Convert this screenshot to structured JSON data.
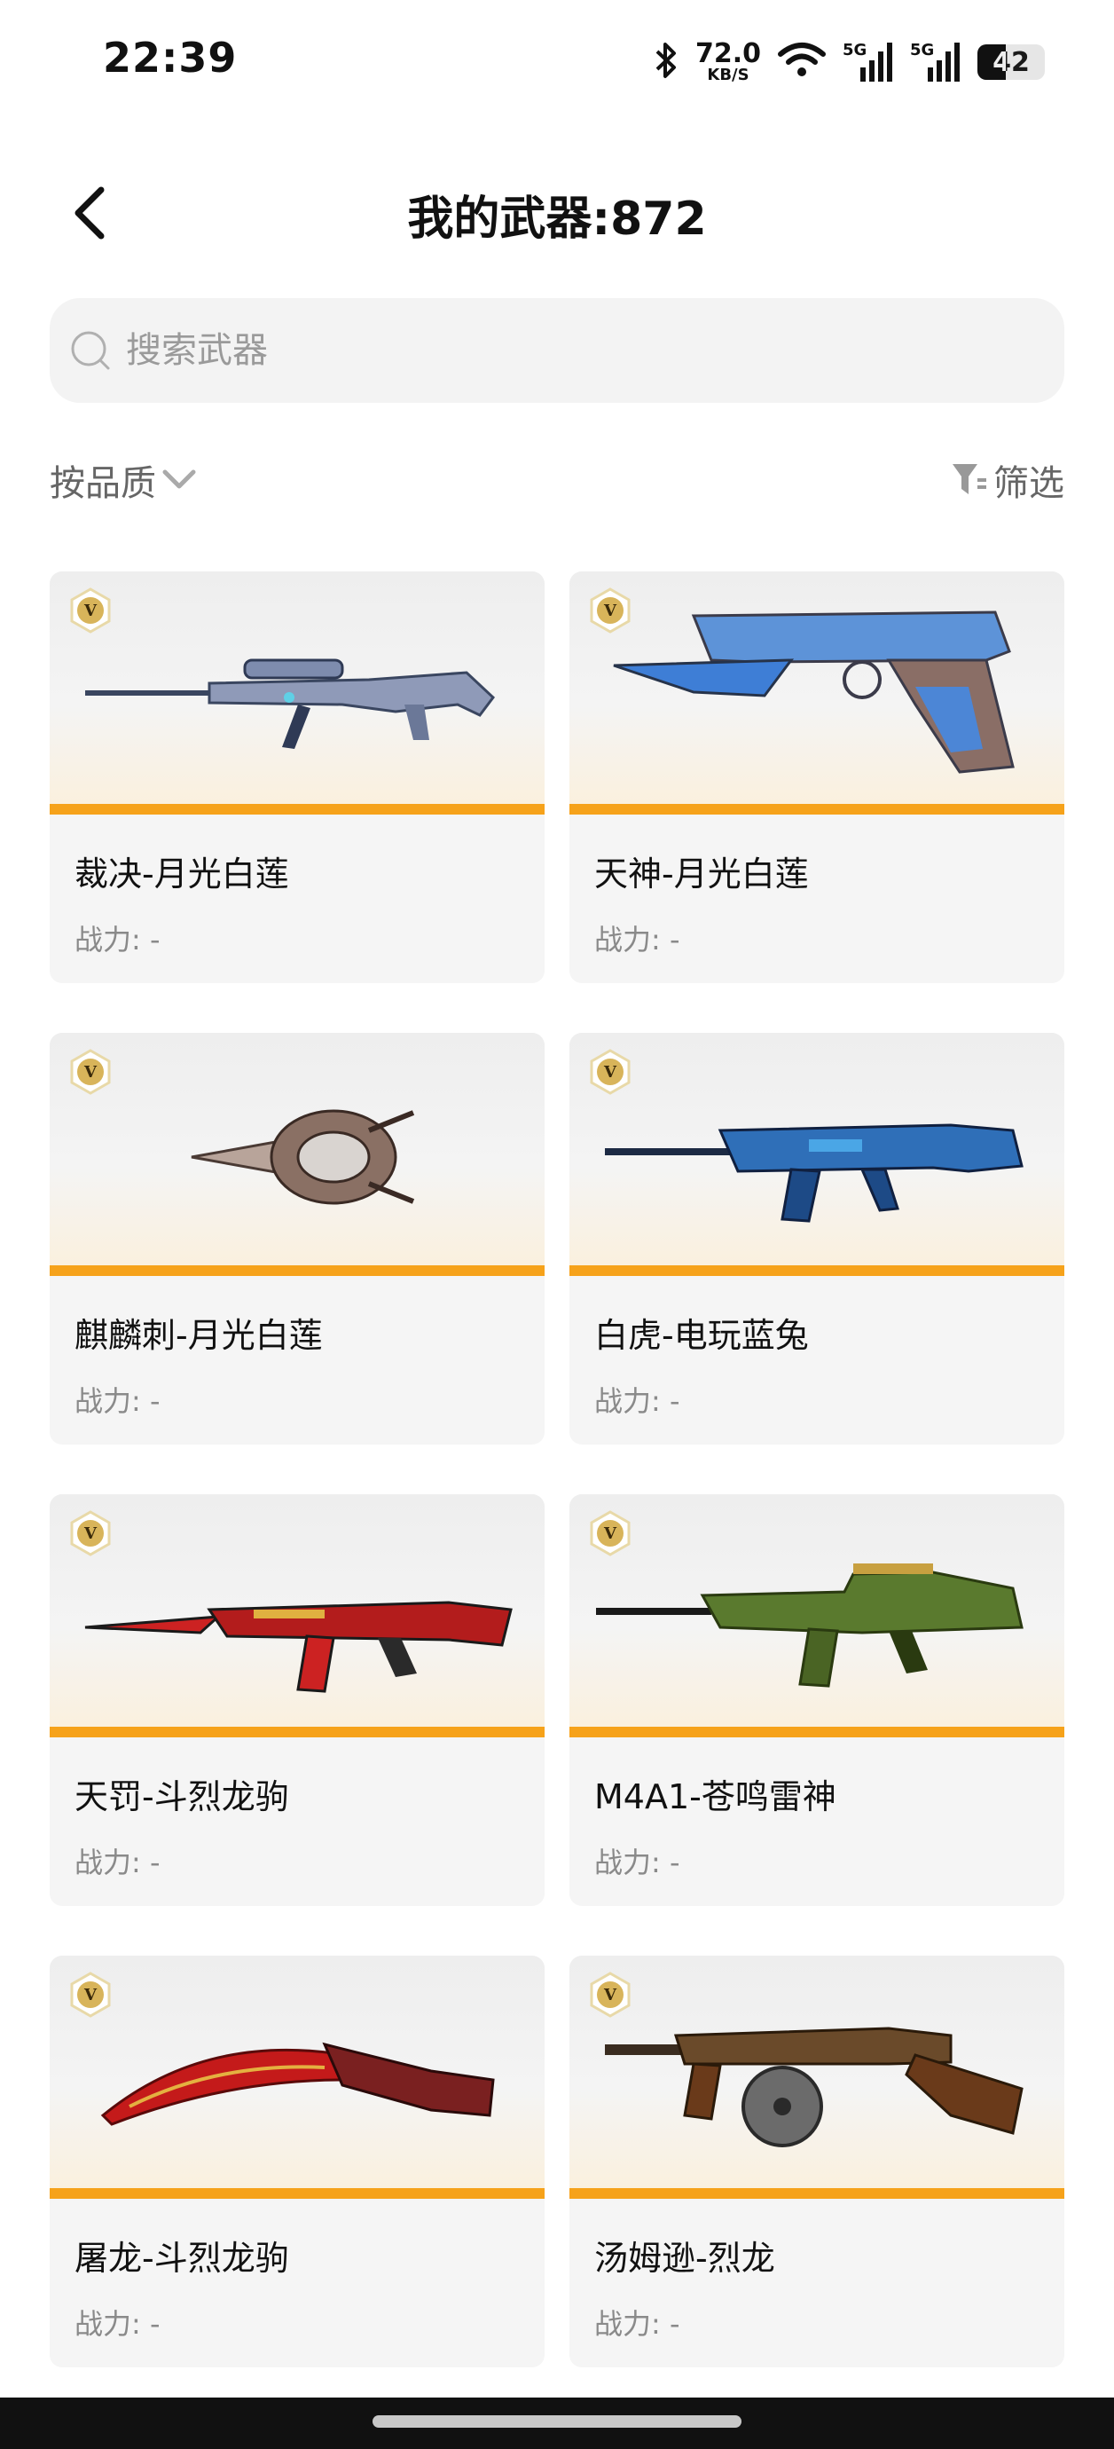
{
  "status_bar": {
    "time": "22:39",
    "net_speed_value": "72.0",
    "net_speed_unit": "KB/S",
    "signal_1_label": "5G",
    "signal_2_label": "5G",
    "battery_level": "42",
    "battery_fraction": 0.42
  },
  "header": {
    "title": "我的武器:872"
  },
  "search": {
    "placeholder": "搜索武器"
  },
  "filters": {
    "sort_label": "按品质",
    "filter_label": "筛选"
  },
  "colors": {
    "accent_orange": "#f6a21a",
    "card_bg": "#f5f5f5",
    "badge_gold": "#d8b45a"
  },
  "weapons": [
    {
      "name": "裁决-月光白莲",
      "power": "战力: -",
      "icon": "sniper-rifle-icon"
    },
    {
      "name": "天神-月光白莲",
      "power": "战力: -",
      "icon": "desert-eagle-pistol-icon"
    },
    {
      "name": "麒麟刺-月光白莲",
      "power": "战力: -",
      "icon": "qilin-dagger-icon"
    },
    {
      "name": "白虎-电玩蓝兔",
      "power": "战力: -",
      "icon": "assault-rifle-icon"
    },
    {
      "name": "天罚-斗烈龙驹",
      "power": "战力: -",
      "icon": "ak-rifle-icon"
    },
    {
      "name": "M4A1-苍鸣雷神",
      "power": "战力: -",
      "icon": "m4a1-rifle-icon"
    },
    {
      "name": "屠龙-斗烈龙驹",
      "power": "战力: -",
      "icon": "dragon-blade-icon"
    },
    {
      "name": "汤姆逊-烈龙",
      "power": "战力: -",
      "icon": "thompson-smg-icon"
    }
  ]
}
